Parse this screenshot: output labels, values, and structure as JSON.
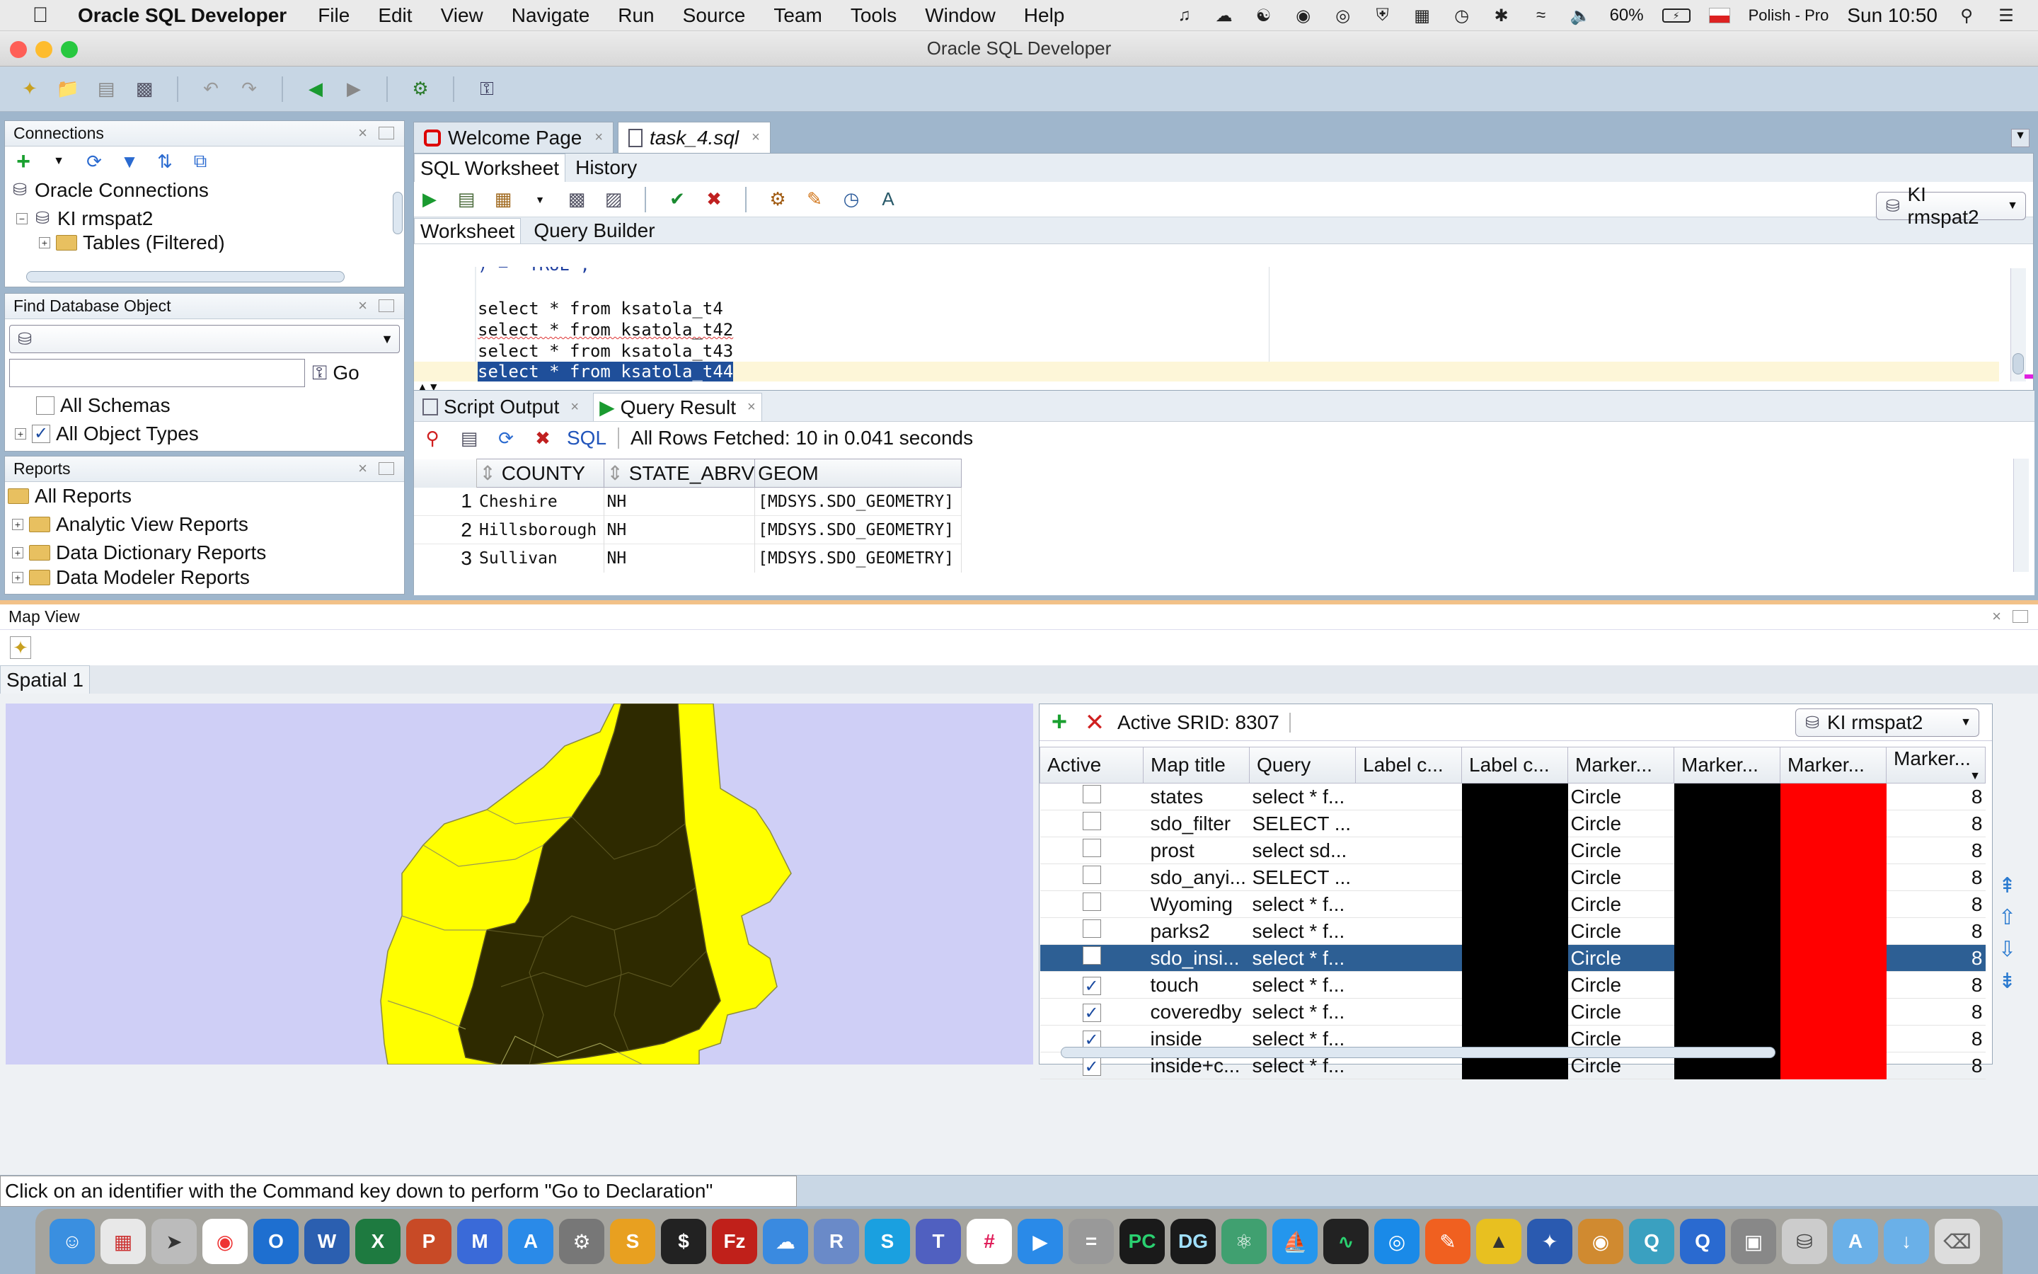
{
  "menubar": {
    "app_name": "Oracle SQL Developer",
    "items": [
      "File",
      "Edit",
      "View",
      "Navigate",
      "Run",
      "Source",
      "Team",
      "Tools",
      "Window",
      "Help"
    ],
    "battery": "60%",
    "input_source": "Polish - Pro",
    "clock": "Sun 10:50"
  },
  "window": {
    "title": "Oracle SQL Developer"
  },
  "connections": {
    "title": "Connections",
    "root": "Oracle Connections",
    "conn": "KI rmspat2",
    "child": "Tables (Filtered)"
  },
  "find": {
    "title": "Find Database Object",
    "go": "Go",
    "all_schemas": "All Schemas",
    "all_object_types": "All Object Types"
  },
  "reports": {
    "title": "Reports",
    "items": [
      "All Reports",
      "Analytic View Reports",
      "Data Dictionary Reports",
      "Data Modeler Reports"
    ]
  },
  "tabs": {
    "welcome": "Welcome Page",
    "task": "task_4.sql",
    "sql_worksheet": "SQL Worksheet",
    "history": "History",
    "worksheet": "Worksheet",
    "query_builder": "Query Builder",
    "connection": "KI rmspat2"
  },
  "editor": {
    "partial": ") = 'TRUE';",
    "lines": [
      "select * from ksatola_t4",
      "select * from ksatola_t42",
      "select * from ksatola_t43",
      "select * from ksatola_t44"
    ]
  },
  "results": {
    "script_output": "Script Output",
    "query_result": "Query Result",
    "sql": "SQL",
    "fetched": "All Rows Fetched: 10 in 0.041 seconds",
    "headers": [
      "COUNTY",
      "STATE_ABRV",
      "GEOM"
    ],
    "rows": [
      [
        "1",
        "Cheshire",
        "NH",
        "[MDSYS.SDO_GEOMETRY]"
      ],
      [
        "2",
        "Hillsborough",
        "NH",
        "[MDSYS.SDO_GEOMETRY]"
      ],
      [
        "3",
        "Sullivan",
        "NH",
        "[MDSYS.SDO_GEOMETRY]"
      ]
    ]
  },
  "mapview": {
    "title": "Map View",
    "spatial_tab": "Spatial 1",
    "srid": "Active SRID: 8307",
    "connection": "KI rmspat2",
    "headers": [
      "Active",
      "Map title",
      "Query",
      "Label c...",
      "Label c...",
      "Marker...",
      "Marker...",
      "Marker...",
      "Marker..."
    ],
    "layers": [
      {
        "active": false,
        "title": "states",
        "query": "select * f...",
        "marker": "Circle",
        "size": "8"
      },
      {
        "active": false,
        "title": "sdo_filter",
        "query": "SELECT ...",
        "marker": "Circle",
        "size": "8"
      },
      {
        "active": false,
        "title": "prost",
        "query": "select sd...",
        "marker": "Circle",
        "size": "8"
      },
      {
        "active": false,
        "title": "sdo_anyi...",
        "query": "SELECT ...",
        "marker": "Circle",
        "size": "8"
      },
      {
        "active": false,
        "title": "Wyoming",
        "query": "select * f...",
        "marker": "Circle",
        "size": "8"
      },
      {
        "active": false,
        "title": "parks2",
        "query": "select * f...",
        "marker": "Circle",
        "size": "8"
      },
      {
        "active": false,
        "title": "sdo_insi...",
        "query": "select * f...",
        "marker": "Circle",
        "size": "8",
        "selected": true
      },
      {
        "active": true,
        "title": "touch",
        "query": "select * f...",
        "marker": "Circle",
        "size": "8"
      },
      {
        "active": true,
        "title": "coveredby",
        "query": "select * f...",
        "marker": "Circle",
        "size": "8"
      },
      {
        "active": true,
        "title": "inside",
        "query": "select * f...",
        "marker": "Circle",
        "size": "8"
      },
      {
        "active": true,
        "title": "inside+c...",
        "query": "select * f...",
        "marker": "Circle",
        "size": "8"
      }
    ],
    "colors": {
      "map_bg": "#cfcff6",
      "outer": "#ffff00",
      "inner": "#2e2a00",
      "label_color": "#000000",
      "marker_color": "#ff0000",
      "selected": "#2d5f94"
    }
  },
  "status": {
    "message": "Click on an identifier with the Command key down to perform \"Go to Declaration\""
  }
}
